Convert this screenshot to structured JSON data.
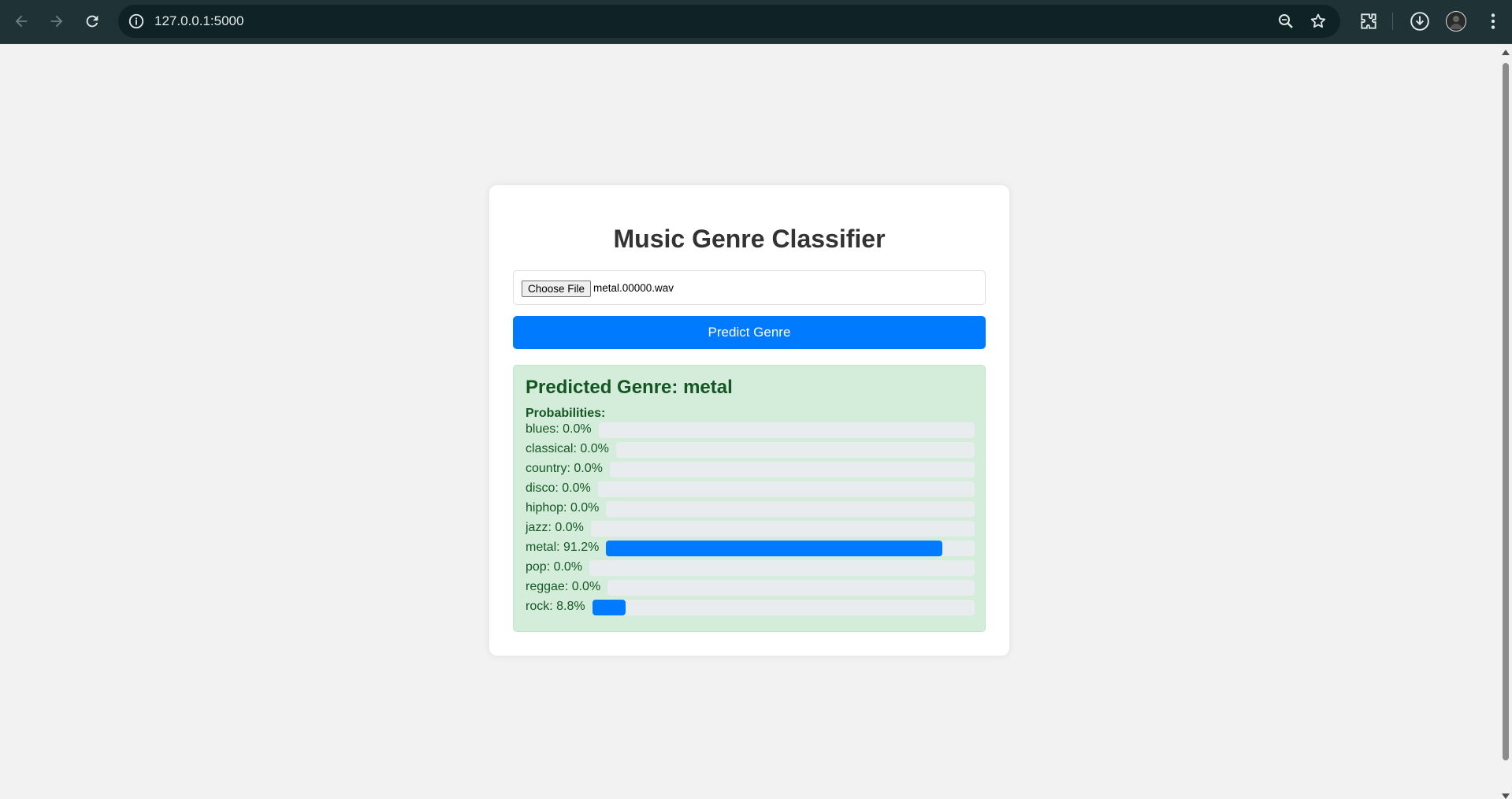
{
  "browser": {
    "url": "127.0.0.1:5000"
  },
  "page": {
    "title": "Music Genre Classifier",
    "file_input": {
      "button_label": "Choose File",
      "file_name": "metal.00000.wav"
    },
    "predict_button_label": "Predict Genre",
    "result": {
      "heading": "Predicted Genre: metal",
      "probabilities_label": "Probabilities:",
      "probabilities": [
        {
          "label": "blues: 0.0%",
          "value": 0.0
        },
        {
          "label": "classical: 0.0%",
          "value": 0.0
        },
        {
          "label": "country: 0.0%",
          "value": 0.0
        },
        {
          "label": "disco: 0.0%",
          "value": 0.0
        },
        {
          "label": "hiphop: 0.0%",
          "value": 0.0
        },
        {
          "label": "jazz: 0.0%",
          "value": 0.0
        },
        {
          "label": "metal: 91.2%",
          "value": 91.2
        },
        {
          "label": "pop: 0.0%",
          "value": 0.0
        },
        {
          "label": "reggae: 0.0%",
          "value": 0.0
        },
        {
          "label": "rock: 8.8%",
          "value": 8.8
        }
      ]
    }
  },
  "colors": {
    "accent": "#007bff",
    "success_bg": "#d4edda",
    "success_text": "#155724",
    "chrome_bg": "#1f3337"
  }
}
